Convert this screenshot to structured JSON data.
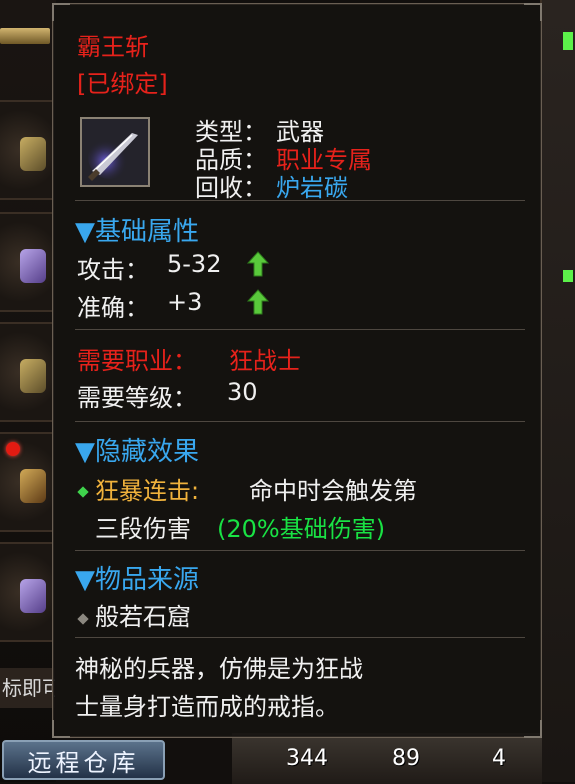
{
  "tooltip": {
    "name": "霸王斩",
    "bound": "[已绑定]",
    "info": {
      "type_label": "类型：",
      "type_value": "武器",
      "quality_label": "品质：",
      "quality_value": "职业专属",
      "recycle_label": "回收：",
      "recycle_value": "炉岩碳"
    },
    "base_section": {
      "title": "▼基础属性",
      "attack_label": "攻击：",
      "attack_value": "5-32",
      "accuracy_label": "准确：",
      "accuracy_value": "+3"
    },
    "requirements": {
      "job_label": "需要职业：",
      "job_value": "狂战士",
      "level_label": "需要等级：",
      "level_value": "30"
    },
    "hidden_section": {
      "title": "▼隐藏效果",
      "effect_name": "狂暴连击:",
      "effect_desc_1": "命中时会触发第",
      "effect_desc_2": "三段伤害",
      "effect_bonus": "(20%基础伤害)"
    },
    "source_section": {
      "title": "▼物品来源",
      "source": "般若石窟"
    },
    "description": {
      "line1": "神秘的兵器，仿佛是为狂战",
      "line2": "士量身打造而成的戒指。"
    }
  },
  "background": {
    "left_label": "标即可",
    "warehouse_button": "远程仓库",
    "counts": [
      "344",
      "89",
      "4"
    ]
  },
  "colors": {
    "title_red": "#e6221b",
    "section_blue": "#39a7ee",
    "bonus_green": "#19e244",
    "effect_gold": "#f0b23c"
  },
  "icons": {
    "upgrade_arrow": "green-up-arrow-icon",
    "bullet": "diamond-bullet-icon",
    "item": "sword-icon"
  }
}
